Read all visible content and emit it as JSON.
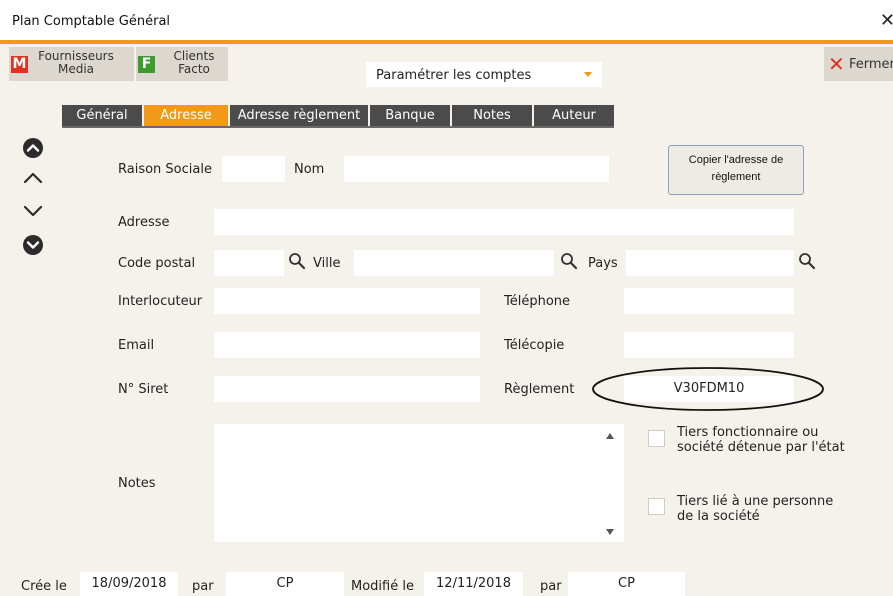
{
  "window": {
    "title": "Plan Comptable Général",
    "close_glyph": "✕"
  },
  "toolbar": {
    "fournisseurs": {
      "icon_letter": "M",
      "icon_color": "#e0301e",
      "line1": "Fournisseurs",
      "line2": "Media"
    },
    "clients": {
      "icon_letter": "F",
      "icon_color": "#3c9a2e",
      "line1": "Clients",
      "line2": "Facto"
    },
    "account_select": {
      "value": "Paramétrer les comptes"
    },
    "fermer": {
      "label": "Fermer"
    }
  },
  "tabs": [
    {
      "label": "Général",
      "active": false
    },
    {
      "label": "Adresse",
      "active": true
    },
    {
      "label": "Adresse règlement",
      "active": false
    },
    {
      "label": "Banque",
      "active": false
    },
    {
      "label": "Notes",
      "active": false
    },
    {
      "label": "Auteur",
      "active": false
    }
  ],
  "nav_icons": [
    "first-circle-icon",
    "previous-chevron-icon",
    "next-chevron-icon",
    "last-circle-icon"
  ],
  "form": {
    "raison_sociale_label": "Raison Sociale",
    "raison_sociale_value": "",
    "nom_label": "Nom",
    "nom_value": "",
    "copy_button": {
      "line1": "Copier l'adresse de",
      "line2": "règlement"
    },
    "adresse_label": "Adresse",
    "adresse_value": "",
    "code_postal_label": "Code postal",
    "code_postal_value": "",
    "ville_label": "Ville",
    "ville_value": "",
    "pays_label": "Pays",
    "pays_value": "",
    "interlocuteur_label": "Interlocuteur",
    "interlocuteur_value": "",
    "telephone_label": "Téléphone",
    "telephone_value": "",
    "email_label": "Email",
    "email_value": "",
    "telecopie_label": "Télécopie",
    "telecopie_value": "",
    "siret_label": "N° Siret",
    "siret_value": "",
    "reglement_label": "Règlement",
    "reglement_value": "V30FDM10",
    "notes_label": "Notes",
    "notes_value": "",
    "tiers_fonctionnaire": {
      "line1": "Tiers fonctionnaire ou",
      "line2": "société détenue par l'état",
      "checked": false
    },
    "tiers_lie": {
      "line1": "Tiers lié à une personne",
      "line2": "de la société",
      "checked": false
    }
  },
  "footer": {
    "cree_label": "Crée le",
    "cree_date": "18/09/2018",
    "par1_label": "par",
    "par1_value": "CP",
    "modifie_label": "Modifié le",
    "modifie_date": "12/11/2018",
    "par2_label": "par",
    "par2_value": "CP"
  },
  "colors": {
    "accent": "#f29a18",
    "tab_bg": "#4b4b4b",
    "window_bg": "#f5f2ec"
  }
}
